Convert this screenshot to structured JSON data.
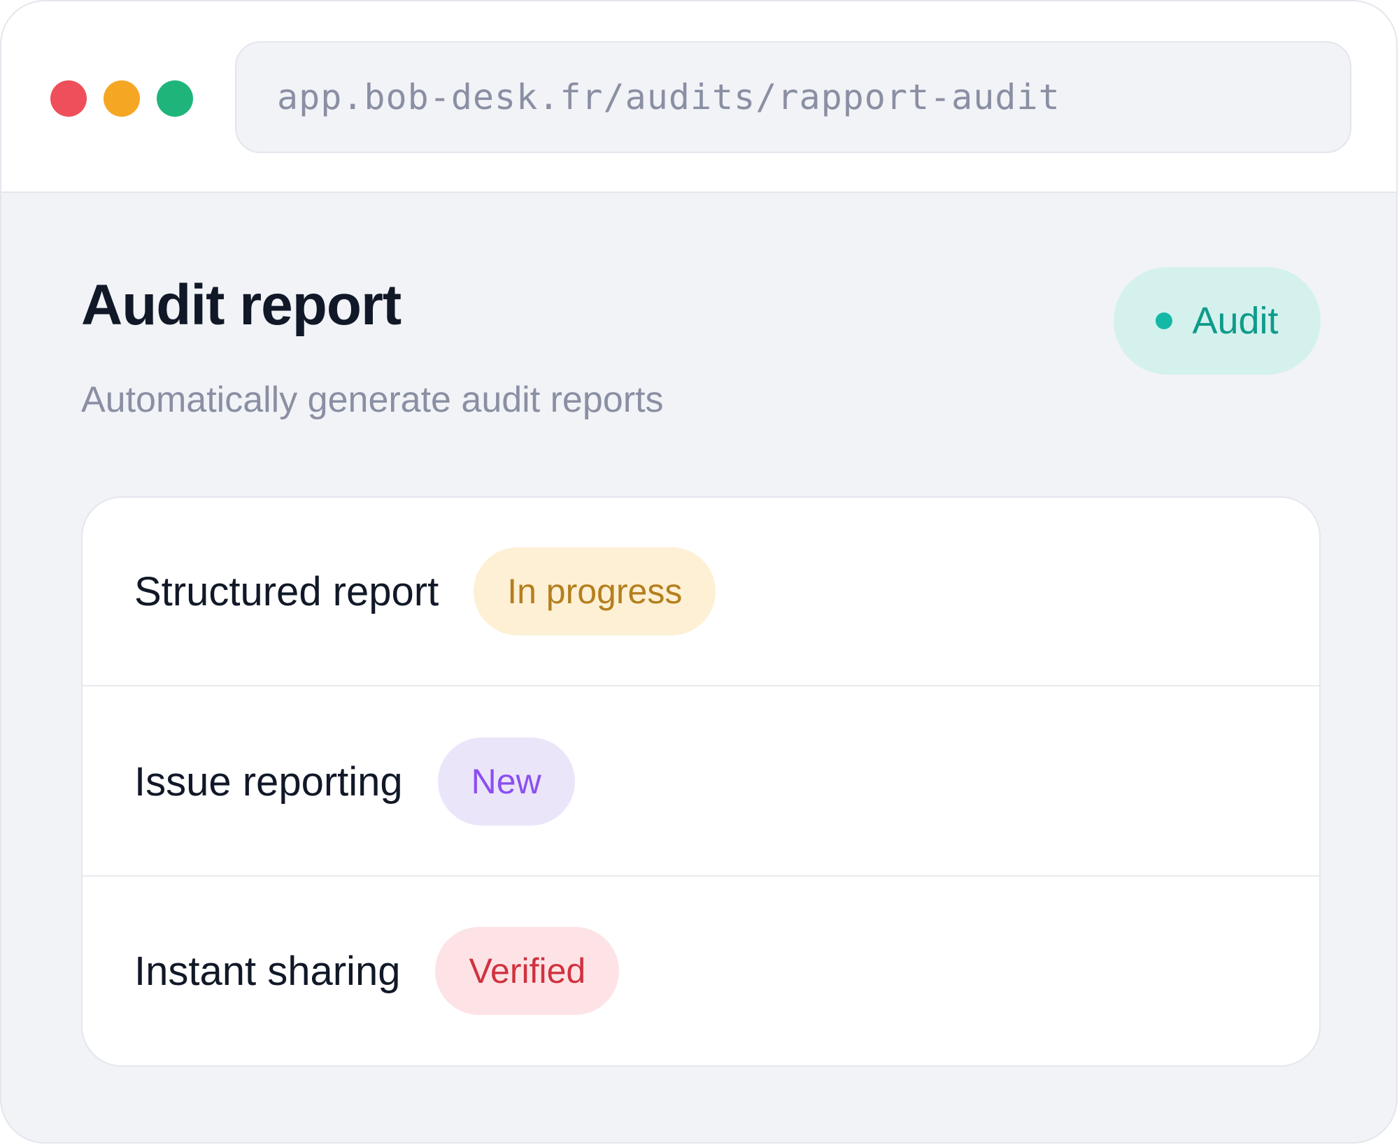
{
  "window": {
    "traffic_lights": [
      {
        "name": "close",
        "color": "#ef4f5a"
      },
      {
        "name": "minimize",
        "color": "#f5a623"
      },
      {
        "name": "maximize",
        "color": "#1fb57a"
      }
    ],
    "url": "app.bob-desk.fr/audits/rapport-audit"
  },
  "header": {
    "title": "Audit report",
    "subtitle": "Automatically generate audit reports",
    "tag": {
      "label": "Audit",
      "bg_color": "#d5f1ee",
      "text_color": "#0f9b8a",
      "dot_color": "#14b8a6"
    }
  },
  "features": [
    {
      "label": "Structured report",
      "status": "In progress",
      "bg_color": "#fdf0d5",
      "text_color": "#b47f1e"
    },
    {
      "label": "Issue reporting",
      "status": "New",
      "bg_color": "#ebe5fa",
      "text_color": "#8a4ff0"
    },
    {
      "label": "Instant sharing",
      "status": "Verified",
      "bg_color": "#fde3e6",
      "text_color": "#d0323f"
    }
  ]
}
